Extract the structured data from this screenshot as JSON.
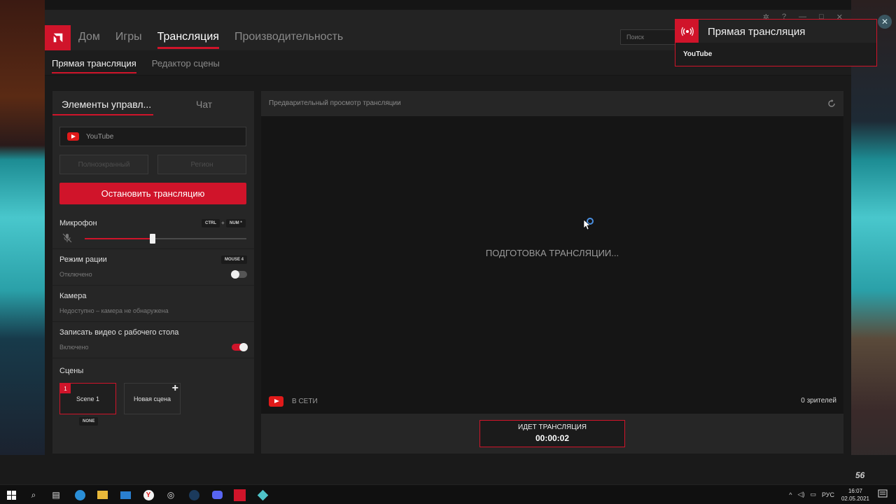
{
  "app": {
    "main_nav": [
      "Дом",
      "Игры",
      "Трансляция",
      "Производительность"
    ],
    "main_nav_active": "Трансляция",
    "search_placeholder": "Поиск",
    "sub_nav": [
      "Прямая трансляция",
      "Редактор сцены"
    ]
  },
  "left_panel": {
    "tabs": [
      "Элементы управл...",
      "Чат"
    ],
    "platform": {
      "name": "YouTube",
      "icon": "youtube-icon"
    },
    "capture_buttons": [
      "Полноэкранный",
      "Регион"
    ],
    "stop_button": "Остановить трансляцию",
    "microphone": {
      "label": "Микрофон",
      "hotkeys": [
        "CTRL",
        "+",
        "NUM *"
      ],
      "volume_fraction": 0.42
    },
    "push_to_talk": {
      "label": "Режим рации",
      "hotkey": "MOUSE 4",
      "status": "Отключено",
      "enabled": false
    },
    "camera": {
      "label": "Камера",
      "status": "Недоступно – камера не обнаружена"
    },
    "desktop_record": {
      "label": "Записать видео с рабочего стола",
      "status": "Включено",
      "enabled": true
    },
    "scenes": {
      "label": "Сцены",
      "items": [
        {
          "number": "1",
          "name": "Scene 1",
          "tag": "NONE"
        },
        {
          "name": "Новая сцена"
        }
      ]
    }
  },
  "preview": {
    "title": "Предварительный просмотр трансляции",
    "status": "ПОДГОТОВКА ТРАНСЛЯЦИИ...",
    "online_label": "В СЕТИ",
    "viewers": "0 зрителей",
    "live_label": "ИДЕТ ТРАНСЛЯЦИЯ",
    "live_time": "00:00:02"
  },
  "notification": {
    "title": "Прямая трансляция",
    "body": "YouTube"
  },
  "desktop": {
    "corner_number": "56"
  },
  "taskbar": {
    "language": "РУС",
    "time": "16:07",
    "date": "02.05.2021"
  },
  "colors": {
    "accent": "#d0142a",
    "youtube": "#e01a1a"
  }
}
